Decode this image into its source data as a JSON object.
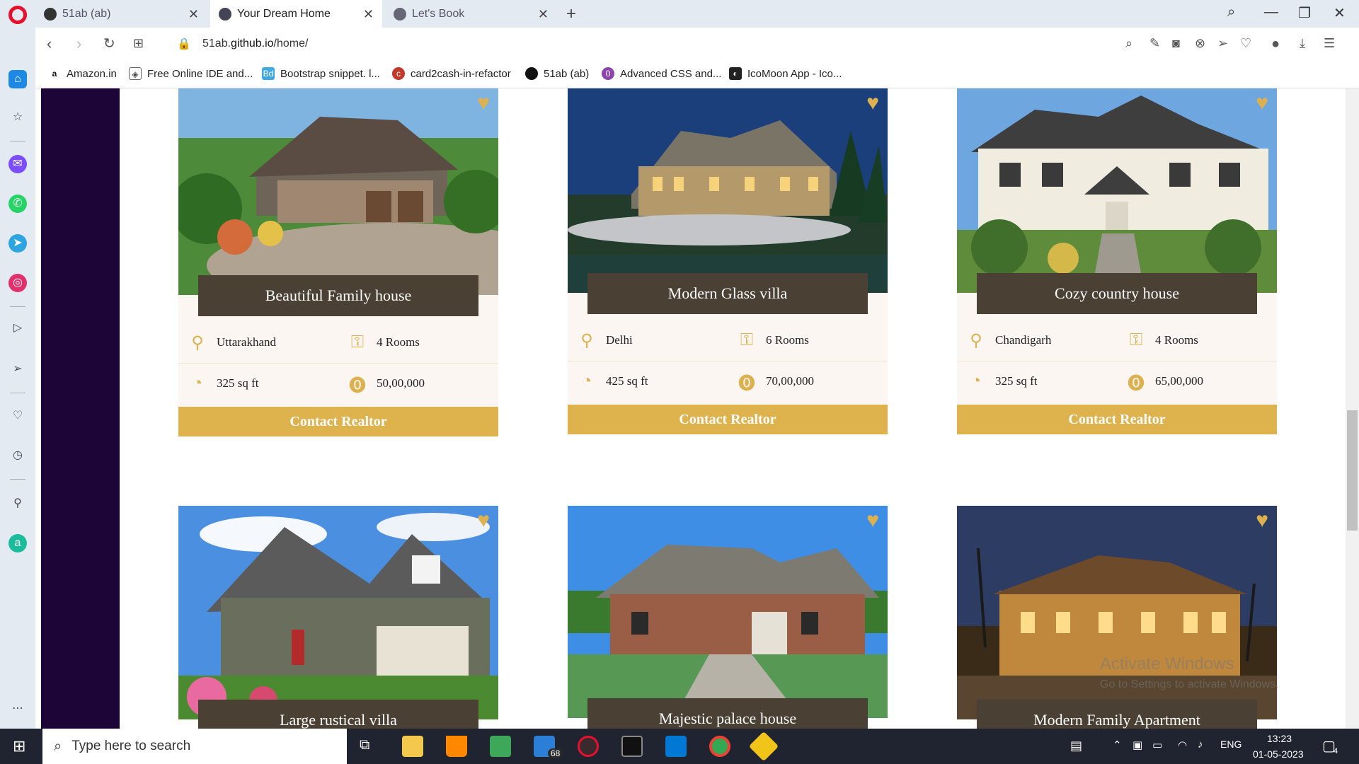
{
  "browser": {
    "tabs": [
      {
        "title": "51ab (ab)",
        "active": false
      },
      {
        "title": "Your Dream Home",
        "active": true
      },
      {
        "title": "Let's Book",
        "active": false
      }
    ],
    "url_rest": "51ab.",
    "url_domain": "github.io",
    "url_path": "/home/",
    "bookmarks": [
      {
        "label": "Amazon.in",
        "icon": "amazon-icon"
      },
      {
        "label": "Free Online IDE and...",
        "icon": "ide-icon"
      },
      {
        "label": "Bootstrap snippet. l...",
        "icon": "bootstrap-icon"
      },
      {
        "label": "card2cash-in-refactor",
        "icon": "card2cash-icon"
      },
      {
        "label": "51ab (ab)",
        "icon": "github-icon"
      },
      {
        "label": "Advanced CSS and...",
        "icon": "css-course-icon"
      },
      {
        "label": "IcoMoon App - Ico...",
        "icon": "icomoon-icon"
      }
    ]
  },
  "listings": [
    {
      "title": "Beautiful Family house",
      "location": "Uttarakhand",
      "rooms": "4 Rooms",
      "area": "325 sq ft",
      "price": "50,00,000",
      "cta": "Contact Realtor"
    },
    {
      "title": "Modern Glass villa",
      "location": "Delhi",
      "rooms": "6 Rooms",
      "area": "425 sq ft",
      "price": "70,00,000",
      "cta": "Contact Realtor"
    },
    {
      "title": "Cozy country house",
      "location": "Chandigarh",
      "rooms": "4 Rooms",
      "area": "325 sq ft",
      "price": "65,00,000",
      "cta": "Contact Realtor"
    },
    {
      "title": "Large rustical villa"
    },
    {
      "title": "Majestic palace house"
    },
    {
      "title": "Modern Family Apartment"
    }
  ],
  "watermark": {
    "line1": "Activate Windows",
    "line2": "Go to Settings to activate Windows."
  },
  "taskbar": {
    "search_placeholder": "Type here to search",
    "mail_badge": "68",
    "lang": "ENG",
    "time": "13:23",
    "date": "01-05-2023",
    "notif_count": "4"
  },
  "colors": {
    "accent": "#deb24d",
    "title_box": "#4a4033",
    "sidebar_dark": "#1e0537"
  }
}
